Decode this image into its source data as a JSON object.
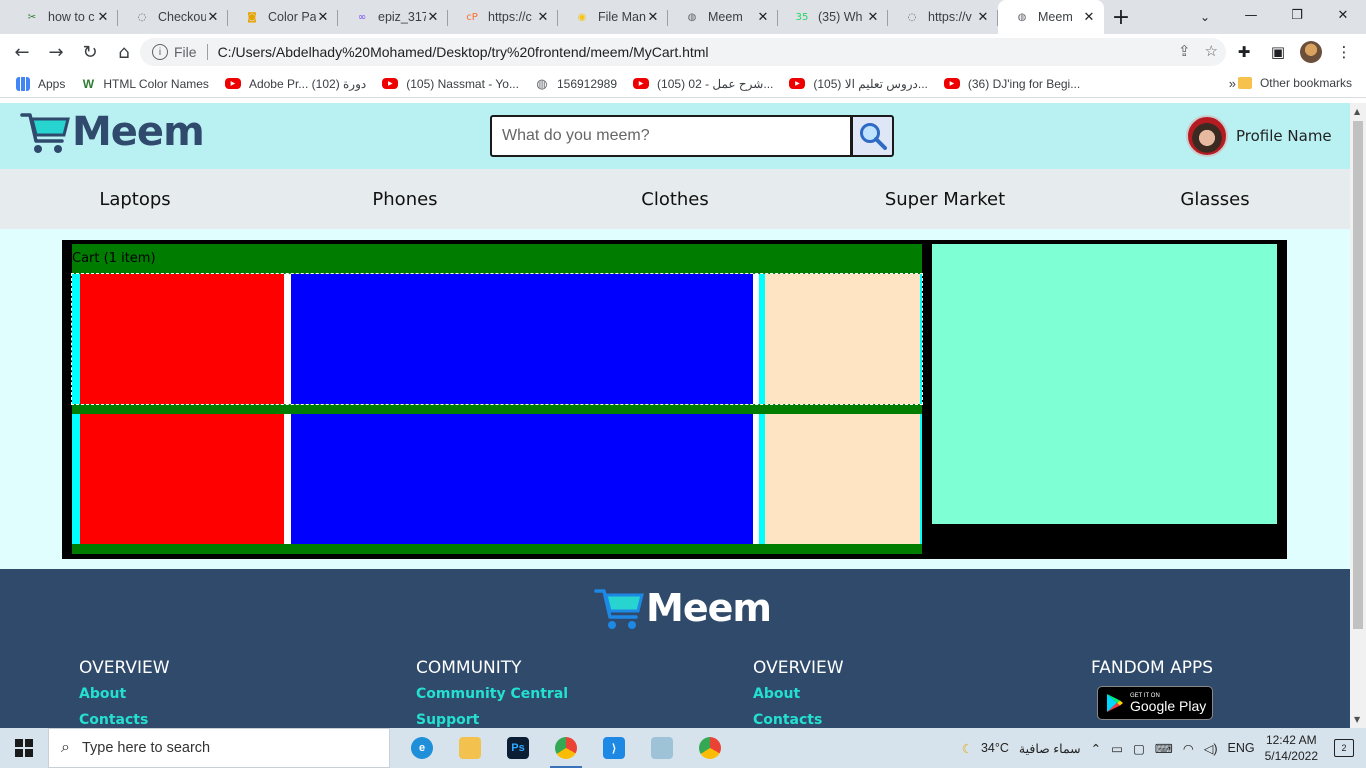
{
  "browser": {
    "tabs": [
      {
        "title": "how to c",
        "icon": "tool-icon",
        "color": "#2e7d32"
      },
      {
        "title": "Checkou",
        "icon": "loading-icon",
        "color": "#555555"
      },
      {
        "title": "Color Pa",
        "icon": "bucket-icon",
        "color": "#e6a400"
      },
      {
        "title": "epiz_317",
        "icon": "infinity-icon",
        "color": "#7c4dff"
      },
      {
        "title": "https://c",
        "icon": "cpanel-icon",
        "color": "#ff6c2c"
      },
      {
        "title": "File Man",
        "icon": "filemanager-icon",
        "color": "#f5c518"
      },
      {
        "title": "Meem",
        "icon": "globe-icon",
        "color": "#5f6368"
      },
      {
        "title": "(35) Wh",
        "icon": "whatsapp-icon",
        "color": "#25d366"
      },
      {
        "title": "https://v",
        "icon": "loading-icon",
        "color": "#555555"
      },
      {
        "title": "Meem",
        "icon": "globe-icon",
        "color": "#5f6368",
        "active": true
      }
    ],
    "address": {
      "scheme_label": "File",
      "url": "C:/Users/Abdelhady%20Mohamed/Desktop/try%20frontend/meem/MyCart.html"
    },
    "bookmarks": [
      {
        "label": "Apps",
        "icon": "apps-grid-icon"
      },
      {
        "label": "HTML Color Names",
        "icon": "w3-icon"
      },
      {
        "label": "Adobe Pr... دورة (102)",
        "icon": "youtube-icon"
      },
      {
        "label": "(105) Nassmat - Yo...",
        "icon": "youtube-icon"
      },
      {
        "label": "156912989",
        "icon": "globe-icon"
      },
      {
        "label": "(105) 02 - شرح عمل...",
        "icon": "youtube-icon"
      },
      {
        "label": "(105) دروس تعليم الا...",
        "icon": "youtube-icon"
      },
      {
        "label": "(36) DJ'ing for Begi...",
        "icon": "youtube-icon"
      }
    ],
    "bookmarks_more": "»",
    "other_bookmarks": "Other bookmarks"
  },
  "site": {
    "logo_text": "Meem",
    "search_placeholder": "What do you meem?",
    "profile_name": "Profile Name",
    "categories": [
      "Laptops",
      "Phones",
      "Clothes",
      "Super Market",
      "Glasses"
    ],
    "cart_title": "Cart (1 item)",
    "colors": {
      "header_bg": "#b9f0f2",
      "page_bg": "#e0fefe",
      "cart_bg": "#007d00",
      "item_image": "#ff0000",
      "item_info": "#0000ff",
      "item_price": "#ffe4c4",
      "summary": "#7fffd4",
      "footer_bg": "#2f4a6a",
      "footer_link": "#24e0d0"
    },
    "footer": {
      "logo_text": "Meem",
      "columns": [
        {
          "heading": "OVERVIEW",
          "links": [
            "About",
            "Contacts"
          ]
        },
        {
          "heading": "COMMUNITY",
          "links": [
            "Community Central",
            "Support"
          ]
        },
        {
          "heading": "OVERVIEW",
          "links": [
            "About",
            "Contacts"
          ]
        }
      ],
      "apps_heading": "FANDOM APPS",
      "google_play_small": "GET IT ON",
      "google_play_big": "Google Play"
    }
  },
  "taskbar": {
    "search_placeholder": "Type here to search",
    "weather_temp": "34°C",
    "weather_desc": "سماء صافية",
    "language": "ENG",
    "time": "12:42 AM",
    "date": "5/14/2022",
    "notifications": "2"
  }
}
